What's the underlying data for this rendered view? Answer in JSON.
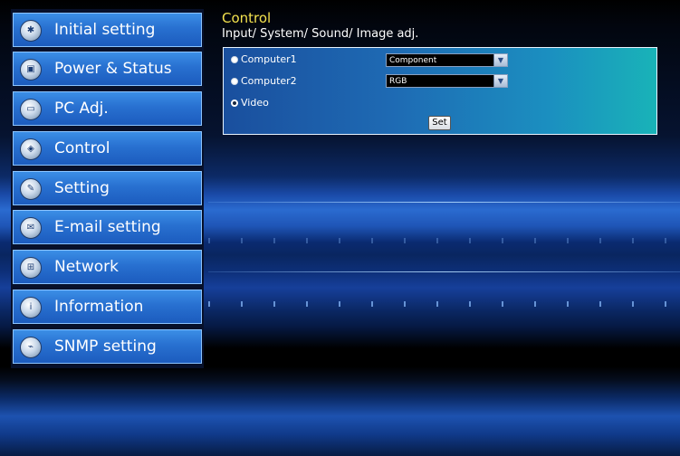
{
  "sidebar": {
    "items": [
      {
        "label": "Initial setting",
        "icon": "initial-setting-icon",
        "glyph": "✱"
      },
      {
        "label": "Power & Status",
        "icon": "power-status-icon",
        "glyph": "▣"
      },
      {
        "label": "PC Adj.",
        "icon": "pc-adj-icon",
        "glyph": "▭"
      },
      {
        "label": "Control",
        "icon": "control-icon",
        "glyph": "◈"
      },
      {
        "label": "Setting",
        "icon": "setting-icon",
        "glyph": "✎"
      },
      {
        "label": "E-mail setting",
        "icon": "email-icon",
        "glyph": "✉"
      },
      {
        "label": "Network",
        "icon": "network-icon",
        "glyph": "⊞"
      },
      {
        "label": "Information",
        "icon": "information-icon",
        "glyph": "i"
      },
      {
        "label": "SNMP setting",
        "icon": "snmp-icon",
        "glyph": "⌁"
      }
    ]
  },
  "content": {
    "title": "Control",
    "subtitle": "Input/ System/ Sound/ Image adj.",
    "inputs": [
      {
        "label": "Computer1",
        "checked": false,
        "select_value": "Component"
      },
      {
        "label": "Computer2",
        "checked": false,
        "select_value": "RGB"
      },
      {
        "label": "Video",
        "checked": true
      }
    ],
    "set_label": "Set"
  },
  "colors": {
    "title": "#f4e24e",
    "nav_button": "#2870d0",
    "panel_start": "#1a4f9e",
    "panel_end": "#19b3b8"
  }
}
